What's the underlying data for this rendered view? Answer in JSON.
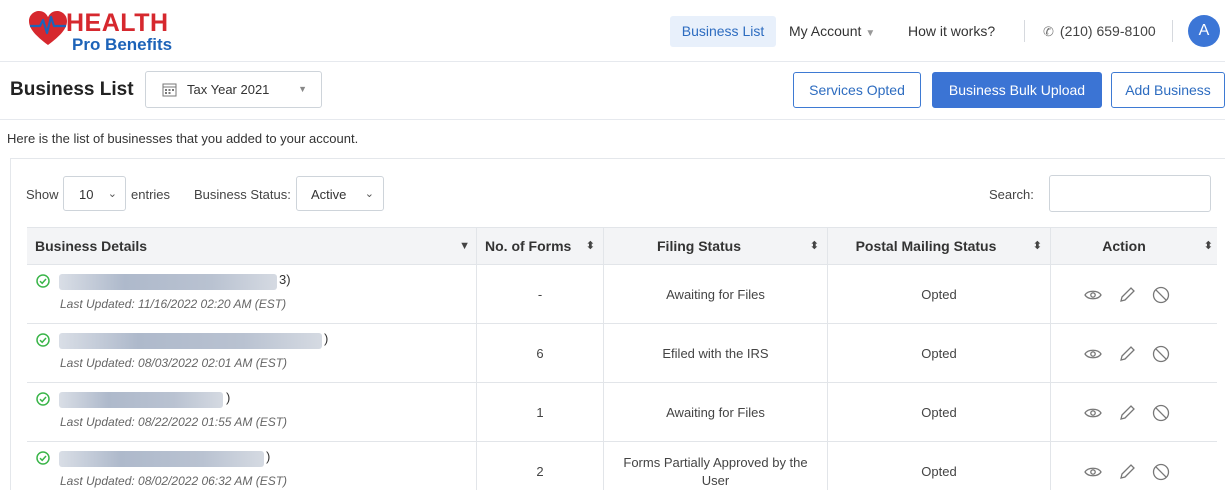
{
  "brand": {
    "line1": "HEALTH",
    "line2": "Pro Benefits",
    "heart_color": "#d6282e",
    "accent_color": "#1d63b8"
  },
  "nav": {
    "business_list": "Business List",
    "my_account": "My Account",
    "how_it_works": "How it works?",
    "phone": "(210) 659-8100",
    "avatar_initial": "A",
    "icons": {
      "phone": "phone-icon",
      "account_caret": "caret-down-icon"
    }
  },
  "header": {
    "title": "Business List",
    "tax_year": "Tax Year 2021",
    "buttons": {
      "services": "Services Opted",
      "bulk": "Business Bulk Upload",
      "add": "Add Business"
    }
  },
  "intro": "Here is the list of businesses that you added to your account.",
  "filters": {
    "show_label": "Show",
    "entries_value": "10",
    "entries_label": "entries",
    "status_label": "Business Status:",
    "status_value": "Active",
    "search_label": "Search:",
    "search_value": ""
  },
  "table": {
    "columns": [
      "Business Details",
      "No. of Forms",
      "Filing Status",
      "Postal Mailing Status",
      "Action"
    ],
    "rows": [
      {
        "name_tail": "3)",
        "updated": "Last Updated: 11/16/2022 02:20 AM (EST)",
        "forms": "-",
        "filing": "Awaiting for Files",
        "postal": "Opted"
      },
      {
        "name_tail": ")",
        "updated": "Last Updated: 08/03/2022 02:01 AM (EST)",
        "forms": "6",
        "filing": "Efiled with the IRS",
        "postal": "Opted"
      },
      {
        "name_tail": ")",
        "updated": "Last Updated: 08/22/2022 01:55 AM (EST)",
        "forms": "1",
        "filing": "Awaiting for Files",
        "postal": "Opted"
      },
      {
        "name_tail": ")",
        "updated": "Last Updated: 08/02/2022 06:32 AM (EST)",
        "forms": "2",
        "filing": "Forms Partially Approved by the User",
        "postal": "Opted"
      }
    ],
    "action_icons": [
      "eye-icon",
      "pencil-icon",
      "ban-icon"
    ],
    "status_icon": "check-circle-icon"
  },
  "colors": {
    "primary": "#3b74d4",
    "active_check": "#3bb54a"
  }
}
